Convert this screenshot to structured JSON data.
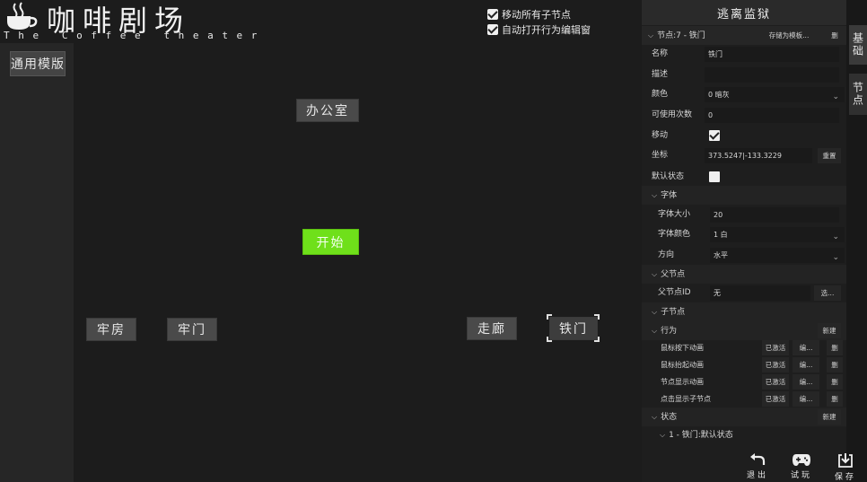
{
  "logo": {
    "title": "咖啡剧场",
    "subtitle": "The Coffee theater"
  },
  "left": {
    "template_button": "通用模版"
  },
  "canvas": {
    "options": [
      {
        "label": "移动所有子节点",
        "checked": true
      },
      {
        "label": "自动打开行为编辑窗",
        "checked": true
      }
    ],
    "nodes": {
      "office": "办公室",
      "start": "开始",
      "cell": "牢房",
      "cell_door": "牢门",
      "corridor": "走廊",
      "iron_door": "铁门"
    },
    "start_color": "#6fe01a"
  },
  "panel": {
    "title": "逃离监狱",
    "tabs": [
      "基础",
      "节点"
    ],
    "node_header": {
      "label": "节点:7 - 铁门",
      "save_template": "存储为模板...",
      "delete": "删"
    },
    "fields": {
      "name": {
        "label": "名称",
        "value": "铁门"
      },
      "desc": {
        "label": "描述",
        "value": ""
      },
      "color": {
        "label": "颜色",
        "value": "0 暗灰"
      },
      "uses": {
        "label": "可使用次数",
        "value": "0"
      },
      "move": {
        "label": "移动",
        "checked": true
      },
      "coord": {
        "label": "坐标",
        "value": "373.5247|-133.3229",
        "reset": "重置"
      },
      "default_state": {
        "label": "默认状态",
        "checked": false
      }
    },
    "font": {
      "section": "字体",
      "size": {
        "label": "字体大小",
        "value": "20"
      },
      "color": {
        "label": "字体颜色",
        "value": "1 白"
      },
      "direction": {
        "label": "方向",
        "value": "水平"
      }
    },
    "parent": {
      "section": "父节点",
      "id": {
        "label": "父节点ID",
        "value": "无",
        "select": "选..."
      }
    },
    "children": {
      "section": "子节点"
    },
    "behavior": {
      "section": "行为",
      "new": "新建",
      "items": [
        {
          "name": "鼠标按下动画",
          "status": "已激活",
          "edit": "编...",
          "del": "删"
        },
        {
          "name": "鼠标抬起动画",
          "status": "已激活",
          "edit": "编...",
          "del": "删"
        },
        {
          "name": "节点显示动画",
          "status": "已激活",
          "edit": "编...",
          "del": "删"
        },
        {
          "name": "点击显示子节点",
          "status": "已激活",
          "edit": "编...",
          "del": "删"
        }
      ]
    },
    "state": {
      "section": "状态",
      "new": "新建",
      "item": "1 - 铁门:默认状态"
    }
  },
  "toolbar": {
    "exit": {
      "label": "退出",
      "icon": "undo-icon"
    },
    "play": {
      "label": "试玩",
      "icon": "gamepad-icon"
    },
    "save": {
      "label": "保存",
      "icon": "download-icon"
    }
  }
}
